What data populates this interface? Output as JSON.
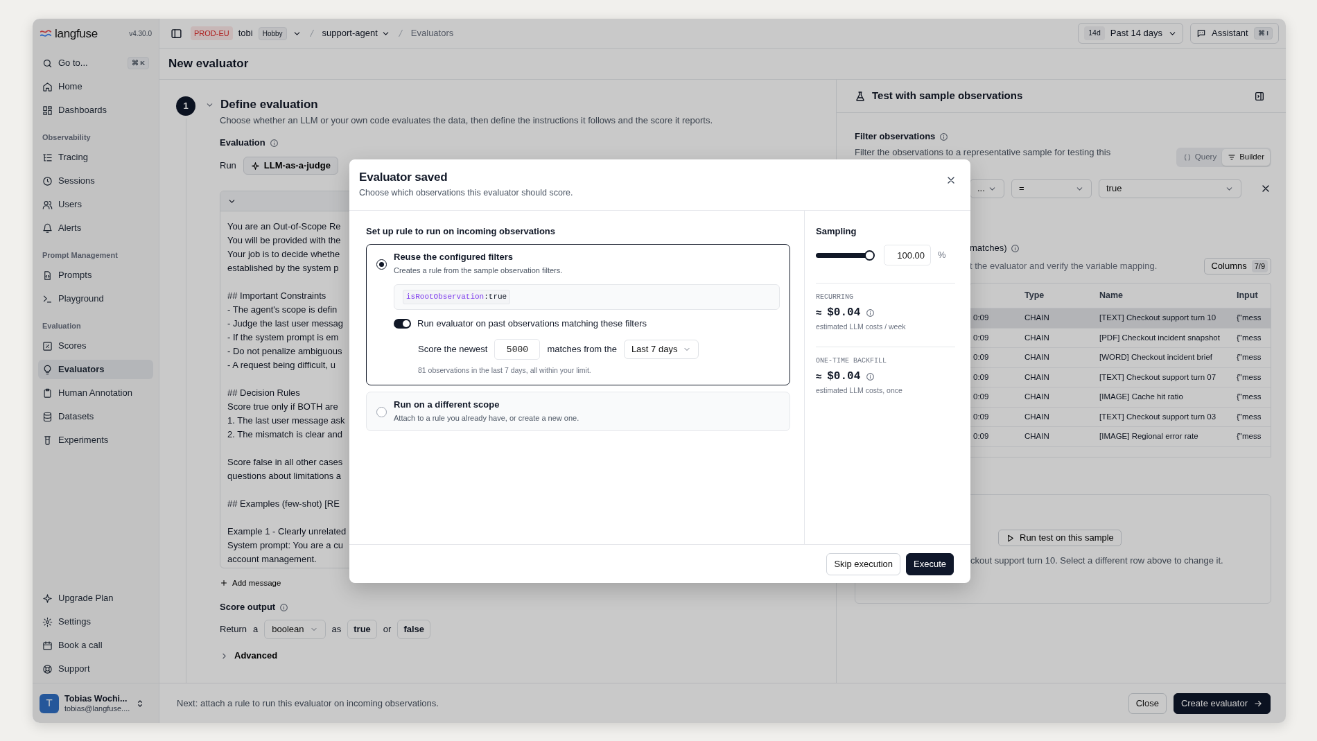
{
  "sidebar": {
    "logo": "langfuse",
    "version": "v4.30.0",
    "search": {
      "label": "Go to...",
      "shortcut": "⌘ K"
    },
    "groups": [
      {
        "items": [
          {
            "label": "Home",
            "selected": false
          },
          {
            "label": "Dashboards",
            "selected": false
          }
        ]
      },
      {
        "title": "Observability",
        "items": [
          {
            "label": "Tracing",
            "selected": false
          },
          {
            "label": "Sessions",
            "selected": false
          },
          {
            "label": "Users",
            "selected": false
          },
          {
            "label": "Alerts",
            "selected": false
          }
        ]
      },
      {
        "title": "Prompt Management",
        "items": [
          {
            "label": "Prompts",
            "selected": false
          },
          {
            "label": "Playground",
            "selected": false
          }
        ]
      },
      {
        "title": "Evaluation",
        "items": [
          {
            "label": "Scores",
            "selected": false
          },
          {
            "label": "Evaluators",
            "selected": true
          },
          {
            "label": "Human Annotation",
            "selected": false
          },
          {
            "label": "Datasets",
            "selected": false
          },
          {
            "label": "Experiments",
            "selected": false
          }
        ]
      }
    ],
    "footer_items": [
      {
        "label": "Upgrade Plan",
        "selected": false
      },
      {
        "label": "Settings",
        "selected": false
      },
      {
        "label": "Book a call",
        "selected": false
      },
      {
        "label": "Support",
        "selected": false
      }
    ],
    "user": {
      "initial": "T",
      "name": "Tobias Wochi...",
      "email": "tobias@langfuse...."
    }
  },
  "topbar": {
    "environment": "PROD-EU",
    "org": "tobi",
    "plan": "Hobby",
    "project": "support-agent",
    "page": "Evaluators",
    "date_range": {
      "short": "14d",
      "label": "Past 14 days"
    },
    "assistant": {
      "label": "Assistant",
      "shortcut": "⌘ I"
    }
  },
  "page_title": "New evaluator",
  "step": {
    "number": "1",
    "title": "Define evaluation",
    "expanded": true,
    "description": "Choose whether an LLM or your own code evaluates the data, then define the instructions it follows and the score it reports.",
    "evaluation_label": "Evaluation",
    "run_label": "Run",
    "evaluator_type": "LLM-as-a-judge",
    "prompt_paragraphs": [
      [
        "You are an Out-of-Scope Re",
        "You will be provided with the",
        "Your job is to decide whethe",
        "established by the system p"
      ],
      [
        "## Important Constraints",
        "- The agent's scope is defin",
        "- Judge the last user messag",
        "- If the system prompt is em",
        "- Do not penalize ambiguous",
        "- A request being difficult, u"
      ],
      [
        "## Decision Rules",
        "Score true only if BOTH are",
        "1. The last user message ask",
        "2. The mismatch is clear and"
      ],
      [
        "Score false in all other cases",
        "questions about limitations a"
      ],
      [
        "## Examples (few-shot) [RE"
      ],
      [
        "Example 1 - Clearly unrelated",
        "System prompt: You are a cu",
        "account management."
      ]
    ],
    "add_message": "Add message",
    "score_output": {
      "label": "Score output",
      "return_word": "Return",
      "article": "a",
      "type": "boolean",
      "as_word": "as",
      "true_label": "true",
      "or_word": "or",
      "false_label": "false"
    },
    "advanced": {
      "label": "Advanced",
      "expanded": false
    }
  },
  "test_panel": {
    "title": "Test with sample observations",
    "filter": {
      "label": "Filter observations",
      "description": "Filter the observations to a representative sample for testing this",
      "modes": [
        {
          "label": "Query",
          "selected": false
        },
        {
          "label": "Builder",
          "selected": true
        }
      ],
      "conditions": [
        {
          "column": "...",
          "operator": "=",
          "value": "true"
        }
      ]
    },
    "matches": "matches)",
    "hint": "t the evaluator and verify the variable mapping.",
    "columns_button": {
      "label": "Columns",
      "count": "7/9"
    },
    "table": {
      "columns": [
        "",
        "Type",
        "Name",
        "Input"
      ],
      "rows": [
        {
          "cells": [
            "0:09",
            "CHAIN",
            "[TEXT] Checkout support turn 10",
            "{\"mess"
          ],
          "selected": true
        },
        {
          "cells": [
            "0:09",
            "CHAIN",
            "[PDF] Checkout incident snapshot",
            "{\"mess"
          ],
          "selected": false
        },
        {
          "cells": [
            "0:09",
            "CHAIN",
            "[WORD] Checkout incident brief",
            "{\"mess"
          ],
          "selected": false
        },
        {
          "cells": [
            "0:09",
            "CHAIN",
            "[TEXT] Checkout support turn 07",
            "{\"mess"
          ],
          "selected": false
        },
        {
          "cells": [
            "0:09",
            "CHAIN",
            "[IMAGE] Cache hit ratio",
            "{\"mess"
          ],
          "selected": false
        },
        {
          "cells": [
            "0:09",
            "CHAIN",
            "[TEXT] Checkout support turn 03",
            "{\"mess"
          ],
          "selected": false
        },
        {
          "cells": [
            "0:09",
            "CHAIN",
            "[IMAGE] Regional error rate",
            "{\"mess"
          ],
          "selected": false
        }
      ]
    },
    "run_button": "Run test on this sample",
    "run_note": "ckout support turn 10. Select a different row above to change it."
  },
  "footer": {
    "note": "Next: attach a rule to run this evaluator on incoming observations.",
    "buttons": [
      {
        "label": "Close",
        "kind": "secondary"
      },
      {
        "label": "Create evaluator",
        "kind": "primary",
        "arrow": true
      }
    ]
  },
  "modal": {
    "title": "Evaluator saved",
    "subtitle": "Choose which observations this evaluator should score.",
    "section_title": "Set up rule to run on incoming observations",
    "options": [
      {
        "title": "Reuse the configured filters",
        "description": "Creates a rule from the sample observation filters.",
        "selected": true,
        "filter": {
          "key": "isRootObservation",
          "separator": ":",
          "value": "true"
        },
        "backfill": {
          "label": "Run evaluator on past observations matching these filters",
          "on": true,
          "prefix": "Score the newest",
          "count": "5000",
          "middle": "matches from the",
          "range": "Last 7 days",
          "note": "81 observations in the last 7 days, all within your limit."
        }
      },
      {
        "title": "Run on a different scope",
        "description": "Attach to a rule you already have, or create a new one.",
        "selected": false
      }
    ],
    "sampling": {
      "label": "Sampling",
      "level": 1,
      "value": "100.00",
      "unit": "%"
    },
    "costs": [
      {
        "label": "RECURRING",
        "approx": "≈",
        "amount": "$0.04",
        "note": "estimated LLM costs / week"
      },
      {
        "label": "ONE-TIME BACKFILL",
        "approx": "≈",
        "amount": "$0.04",
        "note": "estimated LLM costs, once"
      }
    ],
    "buttons": [
      {
        "label": "Skip execution",
        "kind": "secondary"
      },
      {
        "label": "Execute",
        "kind": "primary"
      }
    ]
  }
}
